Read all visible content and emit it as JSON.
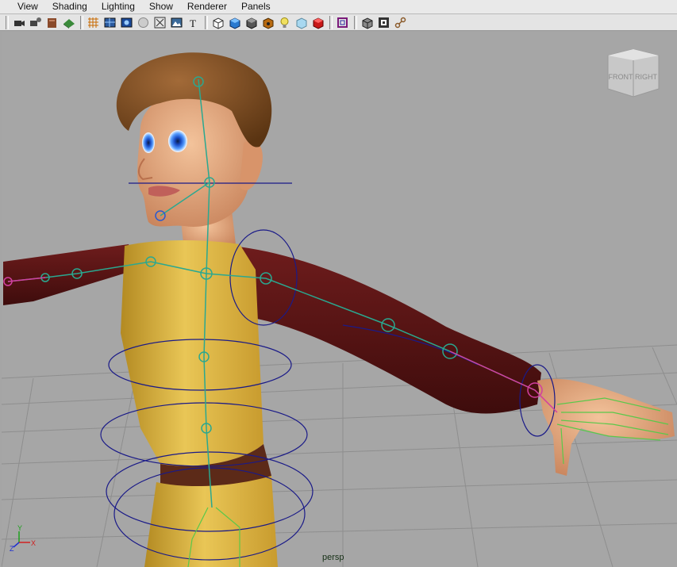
{
  "menu": [
    "View",
    "Shading",
    "Lighting",
    "Show",
    "Renderer",
    "Panels"
  ],
  "toolbar": [
    [
      "select-camera-icon",
      "camera-attributes-icon",
      "bookmark-icon",
      "image-plane-icon"
    ],
    [
      "grid-icon",
      "wireframe-icon",
      "smooth-shade-icon",
      "default-material-icon",
      "xray-icon",
      "texture-icon",
      "text-icon"
    ],
    [
      "isolate-select-icon",
      "shaded-cube-icon",
      "wireframe-cube-icon",
      "textured-cube-icon",
      "light-bulb-icon",
      "xray-joints-icon",
      "red-cube-icon"
    ],
    [
      "resolution-gate-icon"
    ],
    [
      "shaded-wireframe-icon",
      "frame-icon",
      "joint-tool-icon"
    ]
  ],
  "viewcube": {
    "front": "FRONT",
    "right": "RIGHT"
  },
  "camera_label": "persp",
  "axis": {
    "y": "Y",
    "z": "Z",
    "x": "X"
  },
  "colors": {
    "viewport_bg": "#a6a6a6",
    "grid": "#8c8c8c",
    "skin": "#e8a67c",
    "hair": "#7a4a22",
    "shirt": "#d8b23a",
    "sleeve": "#5a1414",
    "joint": "#2a9e8a",
    "ik": "#d23fa0",
    "control": "#1a1a88"
  }
}
